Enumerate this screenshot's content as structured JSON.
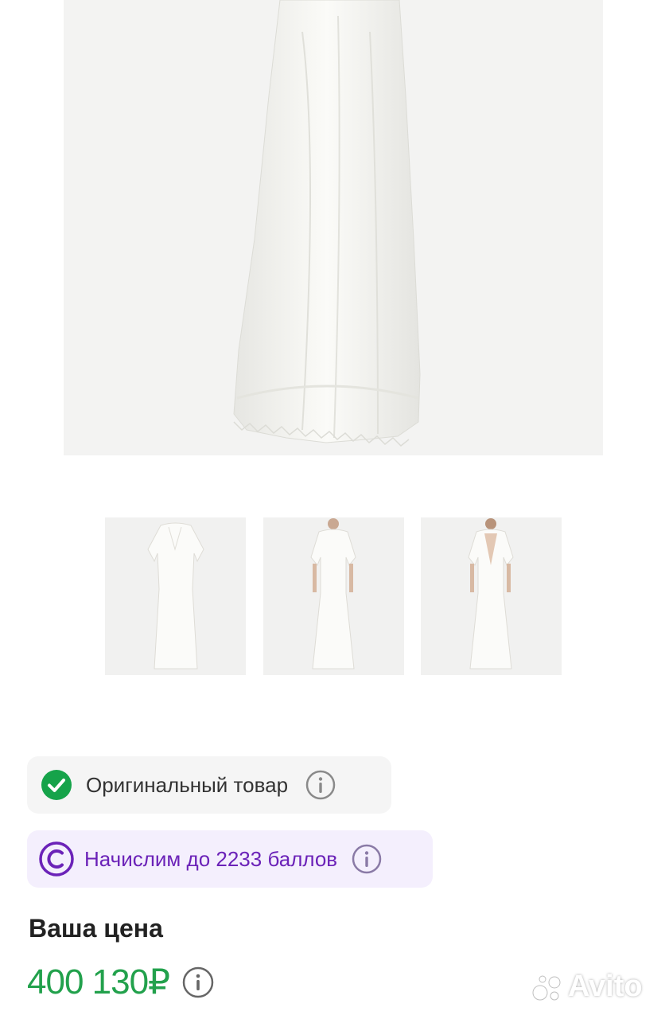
{
  "gallery": {
    "hero_alt": "white lace maxi dress",
    "thumbnails": [
      "front view",
      "model front view",
      "model back view"
    ]
  },
  "badges": {
    "original": {
      "label": "Оригинальный товар",
      "icon": "check-circle-icon"
    },
    "points": {
      "label": "Начислим до 2233 баллов",
      "icon": "c-circle-icon"
    }
  },
  "price": {
    "title": "Ваша цена",
    "value": "400 130₽"
  },
  "watermark": {
    "text": "Avito"
  },
  "colors": {
    "price_green": "#22a14c",
    "points_purple": "#6b22b8",
    "check_green": "#16a34a"
  }
}
